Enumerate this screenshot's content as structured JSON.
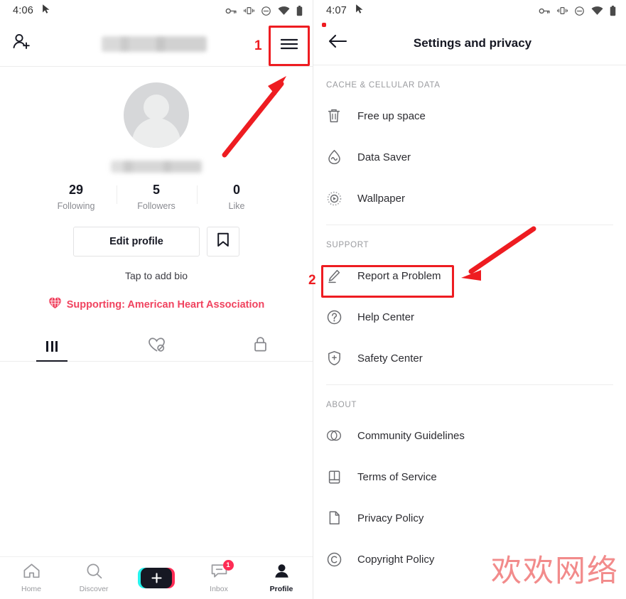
{
  "left": {
    "status": {
      "time": "4:06",
      "icons": [
        "vpn-key-icon",
        "vibrate-icon",
        "do-not-disturb-icon",
        "wifi-icon",
        "battery-icon"
      ]
    },
    "topbar": {
      "add_friend_icon": "add-person-icon",
      "username_blurred": "",
      "menu_icon": "hamburger-menu-icon"
    },
    "profile": {
      "handle_blurred": "",
      "stats": [
        {
          "value": "29",
          "label": "Following"
        },
        {
          "value": "5",
          "label": "Followers"
        },
        {
          "value": "0",
          "label": "Like"
        }
      ],
      "edit_button": "Edit profile",
      "bookmark_icon": "bookmark-icon",
      "bio_placeholder": "Tap to add bio",
      "supporting": "Supporting: American Heart Association",
      "tabs": [
        {
          "icon": "grid-posts-icon",
          "active": true
        },
        {
          "icon": "liked-hidden-icon",
          "active": false
        },
        {
          "icon": "private-lock-icon",
          "active": false
        }
      ]
    },
    "bottom_nav": [
      {
        "label": "Home",
        "icon": "home-icon",
        "active": false
      },
      {
        "label": "Discover",
        "icon": "search-icon",
        "active": false
      },
      {
        "label": "",
        "icon": "create-plus-icon",
        "active": false
      },
      {
        "label": "Inbox",
        "icon": "inbox-icon",
        "badge": "1",
        "active": false
      },
      {
        "label": "Profile",
        "icon": "person-icon",
        "active": true
      }
    ]
  },
  "right": {
    "status": {
      "time": "4:07",
      "icons": [
        "vpn-key-icon",
        "vibrate-icon",
        "do-not-disturb-icon",
        "wifi-icon",
        "battery-icon"
      ]
    },
    "topbar": {
      "back_icon": "back-arrow-icon",
      "title": "Settings and privacy"
    },
    "sections": [
      {
        "header": "CACHE & CELLULAR DATA",
        "items": [
          {
            "label": "Free up space",
            "icon": "trash-icon"
          },
          {
            "label": "Data Saver",
            "icon": "data-saver-drop-icon"
          },
          {
            "label": "Wallpaper",
            "icon": "wallpaper-play-icon"
          }
        ]
      },
      {
        "header": "SUPPORT",
        "items": [
          {
            "label": "Report a Problem",
            "icon": "pencil-edit-icon",
            "highlighted": true
          },
          {
            "label": "Help Center",
            "icon": "question-circle-icon"
          },
          {
            "label": "Safety Center",
            "icon": "shield-plus-icon"
          }
        ]
      },
      {
        "header": "ABOUT",
        "items": [
          {
            "label": "Community Guidelines",
            "icon": "two-circles-icon"
          },
          {
            "label": "Terms of Service",
            "icon": "book-icon"
          },
          {
            "label": "Privacy Policy",
            "icon": "document-icon"
          },
          {
            "label": "Copyright Policy",
            "icon": "copyright-icon"
          }
        ]
      }
    ]
  },
  "annotations": {
    "step1": "1",
    "step2": "2",
    "accent_color": "#ee1c21",
    "watermark": "欢欢网络"
  }
}
